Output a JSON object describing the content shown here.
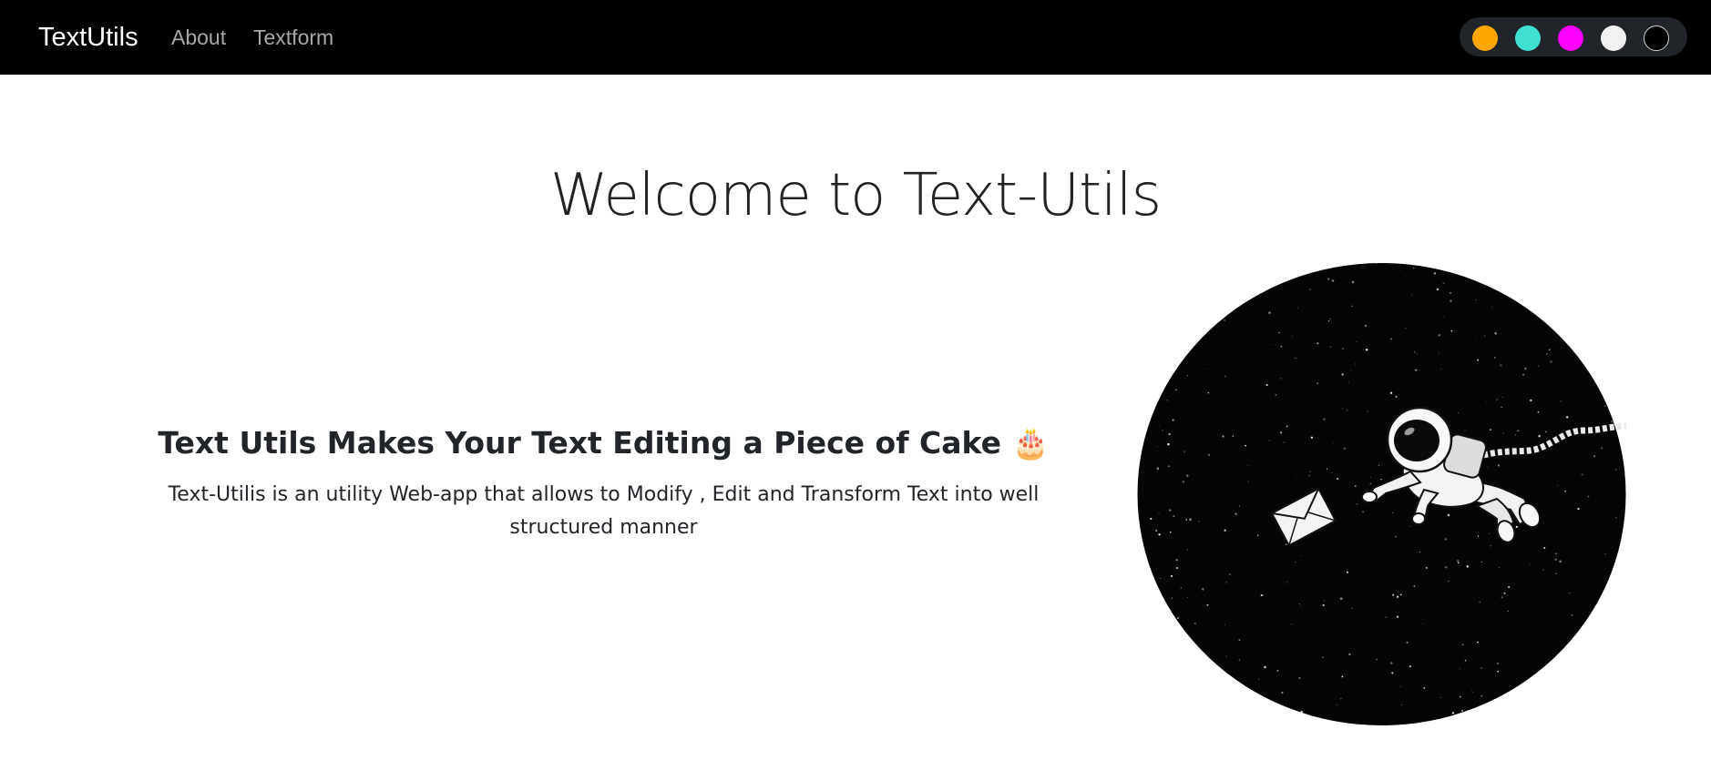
{
  "navbar": {
    "brand": "TextUtils",
    "links": [
      {
        "label": "About"
      },
      {
        "label": "Textform"
      }
    ],
    "theme_swatches": [
      {
        "name": "orange",
        "color": "#ffa500"
      },
      {
        "name": "turquoise",
        "color": "#40e0d0"
      },
      {
        "name": "magenta",
        "color": "#ff00ff"
      },
      {
        "name": "whitesmoke",
        "color": "#f2f2f2"
      },
      {
        "name": "black",
        "color": "#000000"
      }
    ]
  },
  "main": {
    "heading": "Welcome to Text-Utils",
    "tagline": "Text Utils Makes Your Text Editing a Piece of Cake",
    "tagline_emoji": "🎂",
    "description": "Text-Utilis is an utility Web-app that allows to Modify , Edit and Transform Text into well structured manner",
    "hero_image": "astronaut-floating-in-space-with-envelope"
  },
  "colors": {
    "navbar_bg": "#000000",
    "pill_bg": "#212529",
    "text": "#212529",
    "link": "#a8a8a8"
  }
}
